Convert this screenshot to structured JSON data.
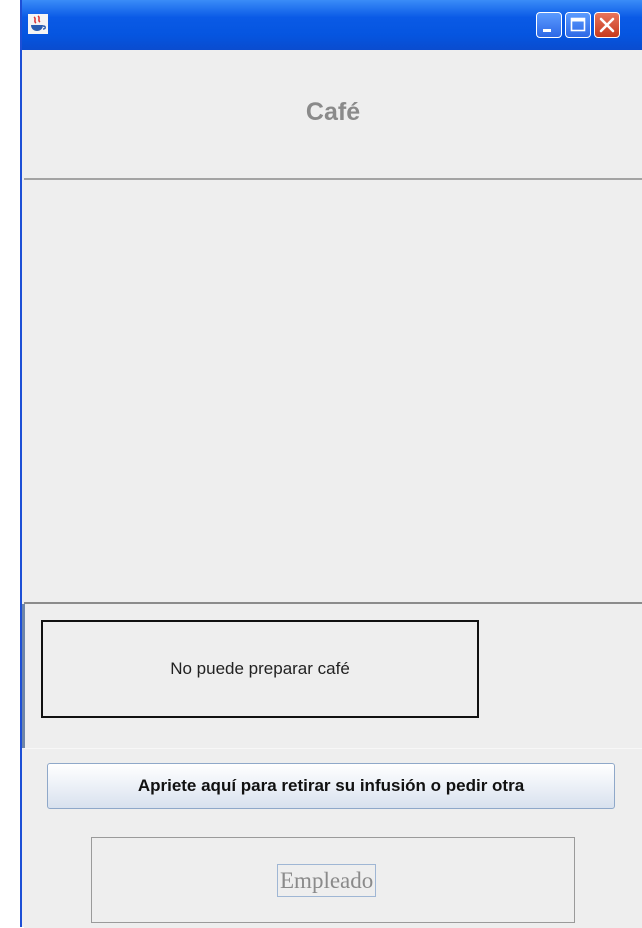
{
  "window": {
    "title": "",
    "icons": {
      "app": "java-coffee-icon",
      "minimize": "minimize-icon",
      "maximize": "maximize-icon",
      "close": "close-icon"
    },
    "colors": {
      "titlebar": "#0a5ae6",
      "close_button": "#c6391c",
      "background": "#eeeeee"
    }
  },
  "header": {
    "title": "Café"
  },
  "status": {
    "message": "No puede preparar café"
  },
  "actions": {
    "retire_button_label": "Apriete aquí para retirar su infusión o pedir otra"
  },
  "employee": {
    "label": "Empleado"
  }
}
